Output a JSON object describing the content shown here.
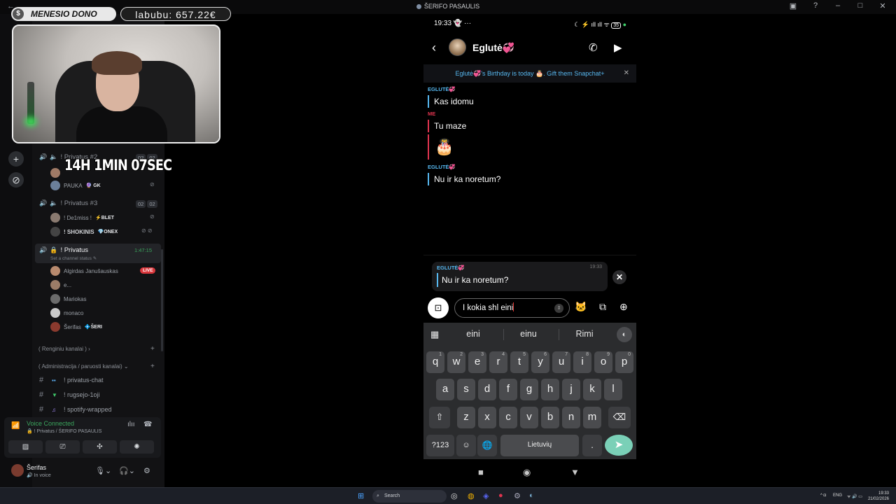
{
  "window": {
    "title": "ŠERIFO PASAULIS"
  },
  "overlay": {
    "dono_label": "MENESIO DONO",
    "goal_text": "labubu: 657.22€",
    "timer": "14H 1MIN 07SEC"
  },
  "sidebar": {
    "channels": [
      {
        "name": "! Privatus #2",
        "counts": [
          "02",
          "02"
        ]
      },
      {
        "name": "! Privatus #3",
        "counts": [
          "02",
          "02"
        ]
      },
      {
        "name": "! Privatus",
        "timer": "1:47:15",
        "status_placeholder": "Set a channel status"
      }
    ],
    "ch2_users": [
      {
        "name": "PAUKA",
        "tag": "GK"
      }
    ],
    "ch3_users": [
      {
        "name": "! De1miss !",
        "tag": "BLET"
      },
      {
        "name": "! SHOKINIS",
        "tag": "ONEX"
      }
    ],
    "privatus_users": [
      {
        "name": "Algirdas Janušauskas",
        "badge": "LIVE"
      },
      {
        "name": "e..."
      },
      {
        "name": "Mariokas"
      },
      {
        "name": "monaco"
      },
      {
        "name": "Šerifas",
        "tag": "ŠERI"
      }
    ],
    "categories": [
      "( Renginiu kanalai )",
      "( Administracija / paruosti kanalai)"
    ],
    "text_channels": [
      "! privatus-chat",
      "! rugsejo-1oji",
      "! spotify-wrapped"
    ]
  },
  "voice": {
    "title": "Voice Connected",
    "subtitle": "! Privatus / ŠERIFO PASAULIS"
  },
  "user": {
    "name": "Šerifas",
    "status": "In voice"
  },
  "phone": {
    "time": "19:33",
    "battery": "35",
    "contact": "Eglutė💞",
    "birthday_banner": "Eglutė💞's Birthday is today 🎂. Gift them Snapchat+",
    "messages": [
      {
        "sender": "EGLUTĖ💞",
        "text": "Kas idomu"
      },
      {
        "sender": "ME",
        "text": "Tu maze",
        "extra": "🎂"
      },
      {
        "sender": "EGLUTĖ💞",
        "text": "Nu ir ka noretum?"
      }
    ],
    "reply": {
      "sender": "EGLUTĖ💞",
      "time": "19:33",
      "text": "Nu ir ka noretum?"
    },
    "input_value": "I kokia shl eini",
    "suggestions": [
      "eini",
      "einu",
      "Rimi"
    ],
    "keyboard": {
      "row1": [
        "q",
        "w",
        "e",
        "r",
        "t",
        "y",
        "u",
        "i",
        "o",
        "p"
      ],
      "row1_nums": [
        "1",
        "2",
        "3",
        "4",
        "5",
        "6",
        "7",
        "8",
        "9",
        "0"
      ],
      "row2": [
        "a",
        "s",
        "d",
        "f",
        "g",
        "h",
        "j",
        "k",
        "l"
      ],
      "row3": [
        "z",
        "x",
        "c",
        "v",
        "b",
        "n",
        "m"
      ],
      "symbols_key": "?123",
      "space_label": "Lietuvių",
      "period": "."
    }
  },
  "taskbar": {
    "search_placeholder": "Search",
    "lang": "ENG",
    "time": "19:33",
    "date": "21/02/2026"
  }
}
